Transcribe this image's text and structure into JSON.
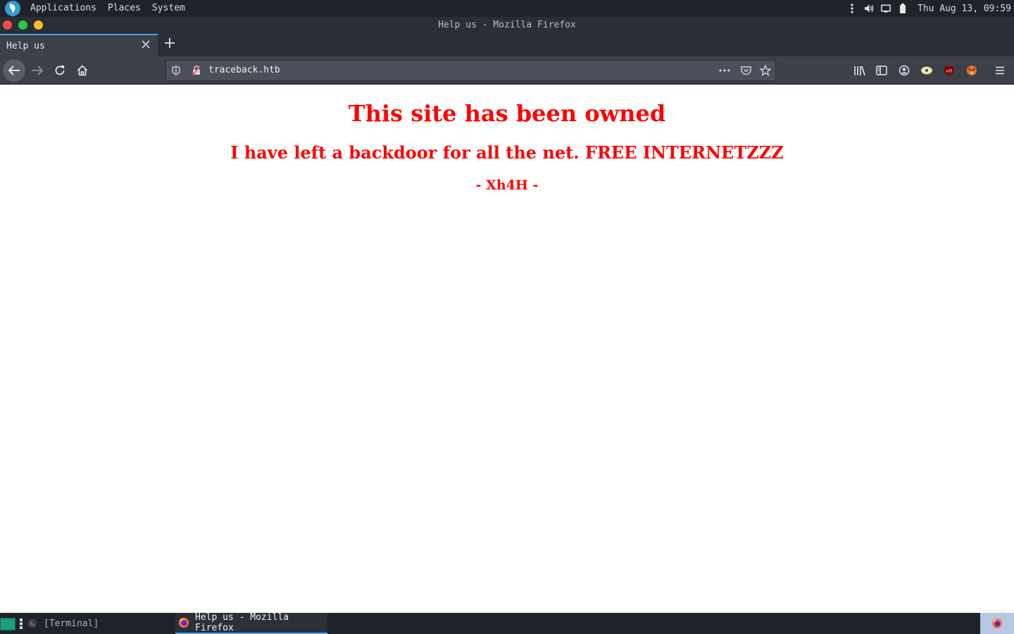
{
  "top_panel": {
    "menus": [
      "Applications",
      "Places",
      "System"
    ],
    "clock": "Thu Aug 13, 09:59"
  },
  "window": {
    "title": "Help us - Mozilla Firefox",
    "controls": {
      "close_color": "#f04a4a",
      "maximize_color": "#2ac84a",
      "minimize_color": "#f5c02c"
    }
  },
  "tabs": [
    {
      "label": "Help us",
      "active": true
    }
  ],
  "urlbar": {
    "value": "traceback.htb"
  },
  "page": {
    "heading": "This site has been owned",
    "subheading": "I have left a backdoor for all the net. FREE INTERNETZZZ",
    "signature": "- Xh4H -",
    "text_color": "#ff0000"
  },
  "taskbar": {
    "tasks": [
      {
        "label": "[Terminal]",
        "active": false
      },
      {
        "label": "Help us - Mozilla Firefox",
        "active": true
      }
    ]
  },
  "colors": {
    "accent": "#45a1ff",
    "panel_bg": "#1f2329",
    "toolbar_bg": "#3c4049"
  }
}
